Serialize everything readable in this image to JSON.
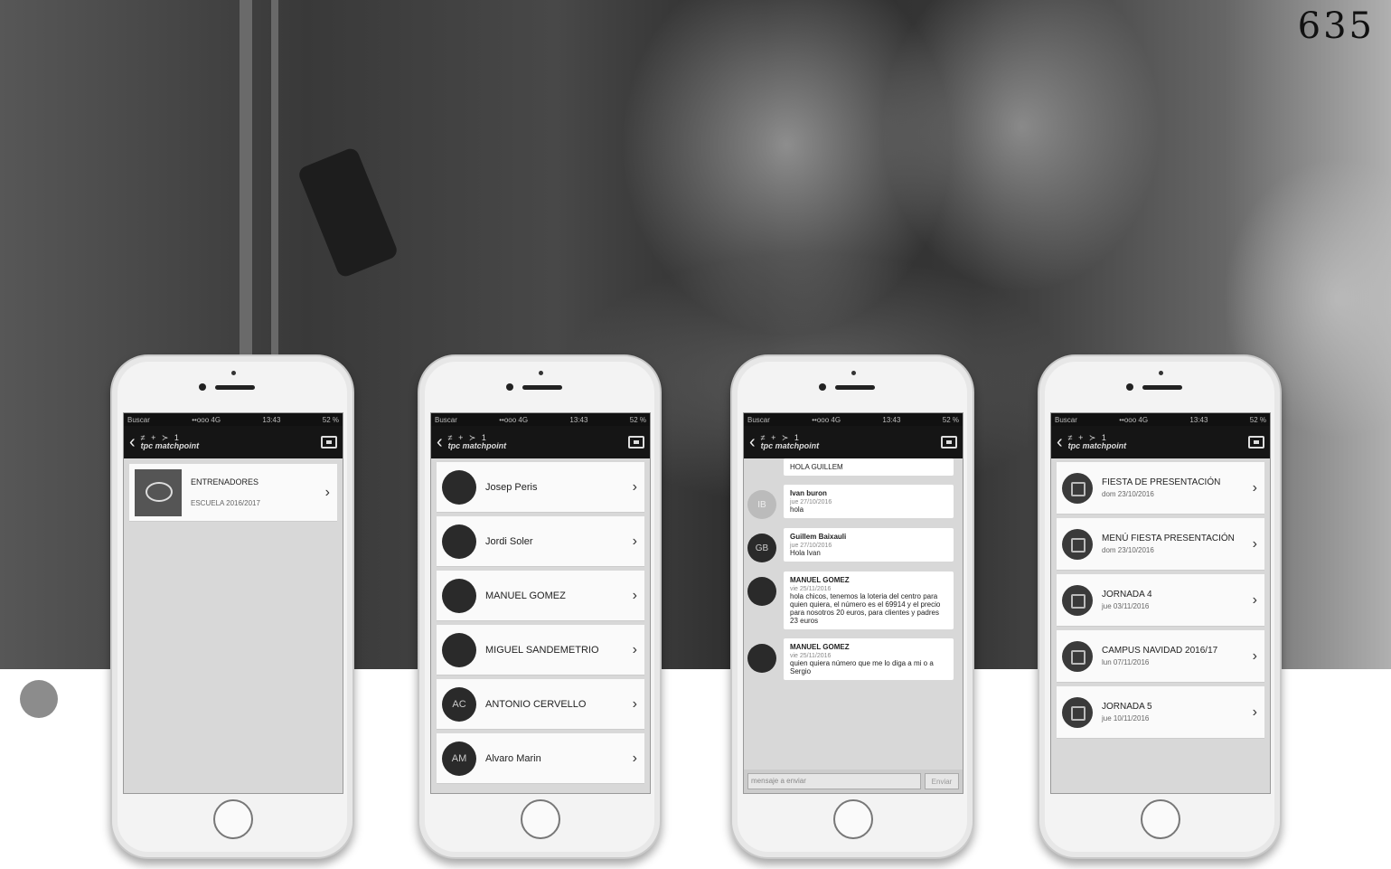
{
  "page_number": "635",
  "app": {
    "status_carrier": "Buscar",
    "status_signal": "••ooo 4G",
    "status_time": "13:43",
    "status_battery": "52 %",
    "status_time_p1": "13:43",
    "logo_symbols": "≠ + ≻ 1",
    "logo_name": "tpc matchpoint"
  },
  "phone1": {
    "rows": [
      {
        "title": "ENTRENADORES",
        "sub": "ESCUELA 2016/2017"
      }
    ]
  },
  "phone2": {
    "contacts": [
      {
        "name": "Josep Peris",
        "initials": ""
      },
      {
        "name": "Jordi Soler",
        "initials": ""
      },
      {
        "name": "MANUEL GOMEZ",
        "initials": ""
      },
      {
        "name": "MIGUEL SANDEMETRIO",
        "initials": ""
      },
      {
        "name": "ANTONIO CERVELLO",
        "initials": "AC"
      },
      {
        "name": "Alvaro Marin",
        "initials": "AM"
      }
    ]
  },
  "phone3": {
    "messages": [
      {
        "author": "",
        "date": "",
        "text": "HOLA GUILLEM",
        "initials": ""
      },
      {
        "author": "Ivan buron",
        "date": "jue 27/10/2016",
        "text": "hola",
        "initials": "IB"
      },
      {
        "author": "Guillem Baixauli",
        "date": "jue 27/10/2016",
        "text": "Hola Ivan",
        "initials": "GB"
      },
      {
        "author": "MANUEL GOMEZ",
        "date": "vie 25/11/2016",
        "text": "hola chicos, tenemos la loteria del centro para quien quiera, el número es el 69914 y el precio para nosotros 20 euros, para clientes y padres 23 euros",
        "initials": ""
      },
      {
        "author": "MANUEL GOMEZ",
        "date": "vie 25/11/2016",
        "text": "quien quiera número que me lo diga a mi o a Sergio",
        "initials": ""
      }
    ],
    "input_placeholder": "mensaje a enviar",
    "send_label": "Enviar"
  },
  "phone4": {
    "events": [
      {
        "title": "FIESTA DE PRESENTACIÓN",
        "date": "dom 23/10/2016"
      },
      {
        "title": "MENÚ FIESTA PRESENTACIÓN",
        "date": "dom 23/10/2016"
      },
      {
        "title": "JORNADA 4",
        "date": "jue 03/11/2016"
      },
      {
        "title": "CAMPUS NAVIDAD 2016/17",
        "date": "lun 07/11/2016"
      },
      {
        "title": "JORNADA 5",
        "date": "jue 10/11/2016"
      }
    ]
  }
}
